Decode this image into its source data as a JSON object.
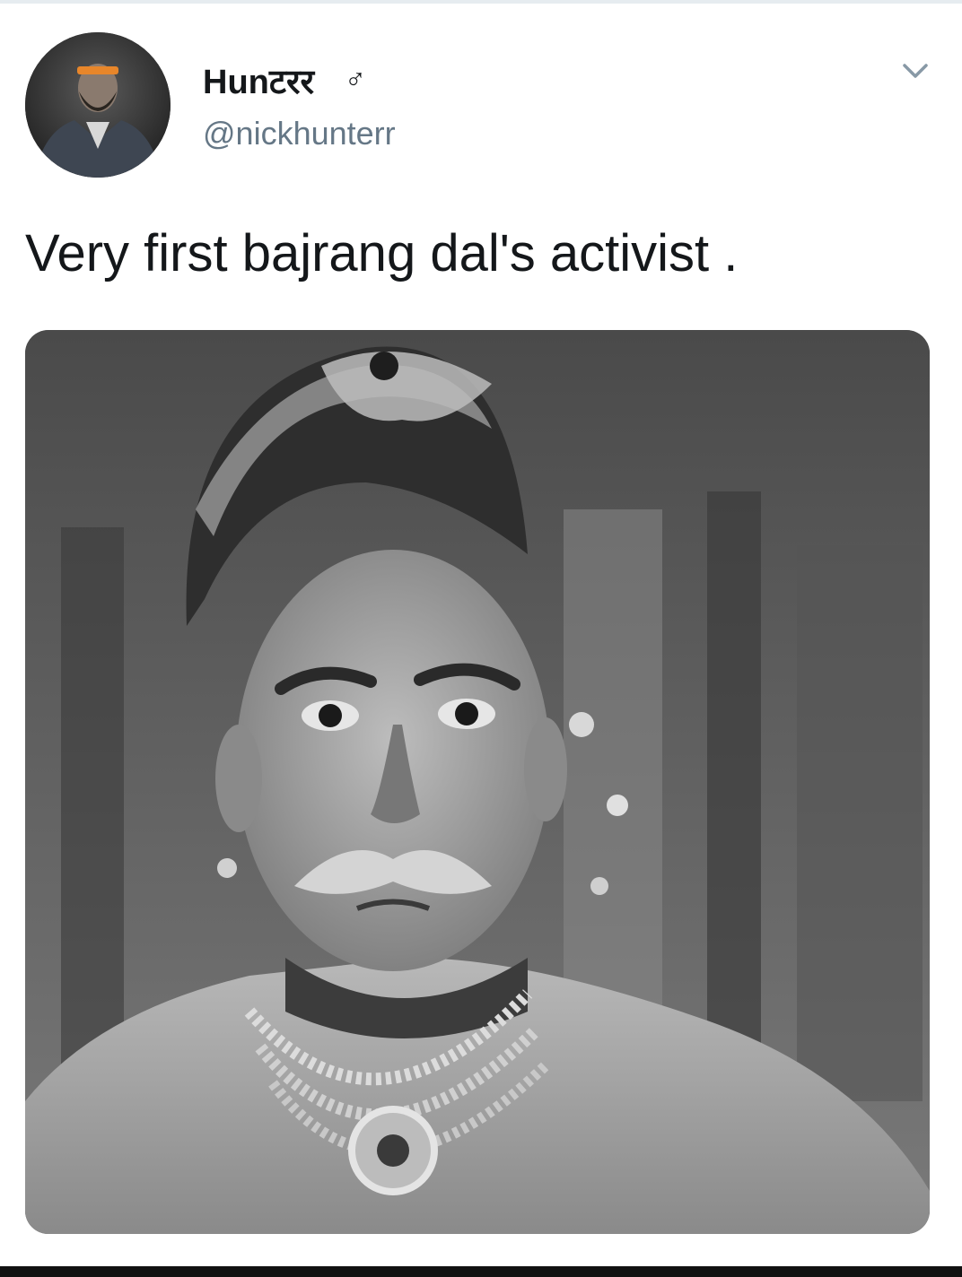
{
  "tweet": {
    "display_name": "Hunटरर",
    "gender_symbol": "♂",
    "handle": "@nickhunterr",
    "text": "Very first bajrang dal's activist .",
    "menu_icon": "chevron-down-icon"
  },
  "colors": {
    "text_primary": "#14171a",
    "text_secondary": "#657786",
    "border": "#e6ecf0"
  }
}
